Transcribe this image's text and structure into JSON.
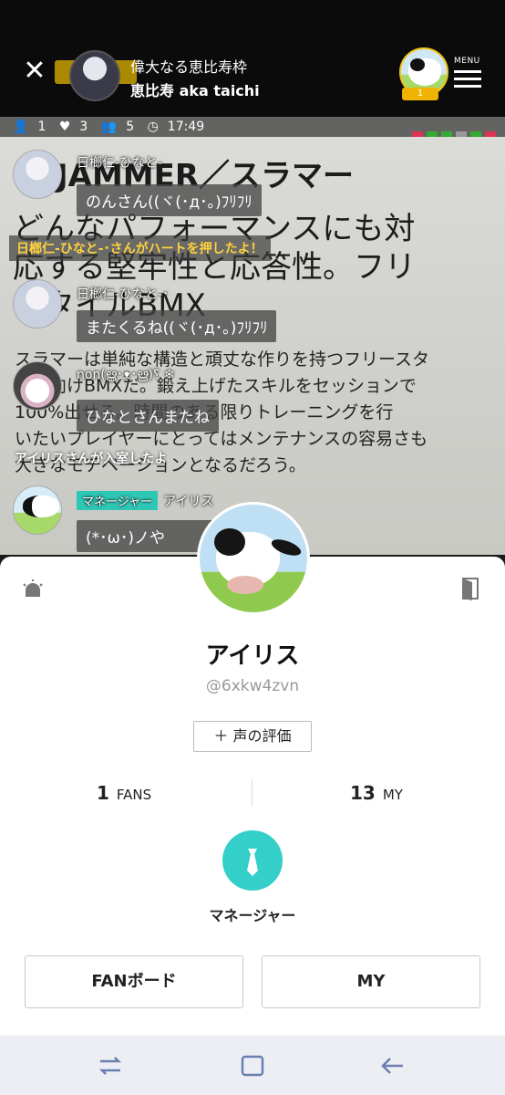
{
  "header": {
    "host_title": "偉大なる恵比寿枠",
    "host_name": "恵比寿 aka taichi",
    "top_listener_count": "1",
    "menu_label": "MENU"
  },
  "stats": {
    "listeners": "1",
    "hearts": "3",
    "fans": "5",
    "time": "17:49"
  },
  "background_text": {
    "headline": "JAMMER／スラマー",
    "line1": "どんなパフォーマンスにも対",
    "line2": "応する堅牢性と応答性。フリ",
    "line3": "スタイルBMX",
    "body1": "スラマーは単純な構造と頑丈な作りを持つフリースタ",
    "body2": "イル向けBMXだ。鍛え上げたスキルをセッションで",
    "body3": "100%出せる。時間のある限りトレーニングを行",
    "body4": "いたいプレイヤーにとってはメンテナンスの容易さも",
    "body5": "大きなモチベーションとなるだろう。"
  },
  "chat": [
    {
      "name": "日榔仁-ひなと-",
      "message": "のんさん((ヾ(･д･｡)ﾌﾘﾌﾘ"
    },
    {
      "name": "日榔仁-ひなと-･",
      "message": "またくるね((ヾ(･д･｡)ﾌﾘﾌﾘ"
    },
    {
      "name": "non(ൠ･ᴥ･ൠ)؟ ❄︎",
      "message": "ひなとさんまたね"
    },
    {
      "role": "マネージャー",
      "name": "アイリス",
      "message": "(*･ω･)ノや"
    }
  ],
  "system_messages": {
    "heart": "日榔仁-ひなと-･さんがハートを押したよ！",
    "enter": "アイリスさんが入室したよ"
  },
  "profile": {
    "name": "アイリス",
    "user_id": "@6xkw4zvn",
    "voice_rating_button": "＋ 声の評価",
    "fans_count": "1",
    "fans_label": "FANS",
    "my_count": "13",
    "my_label": "MY",
    "role": "マネージャー",
    "fan_board_button": "FANボード",
    "my_button": "MY"
  },
  "colors": {
    "accent_teal": "#34cfc8",
    "badge_teal": "#2ec7b6",
    "system_yellow": "#ffd33b",
    "count_badge": "#f0b400"
  }
}
